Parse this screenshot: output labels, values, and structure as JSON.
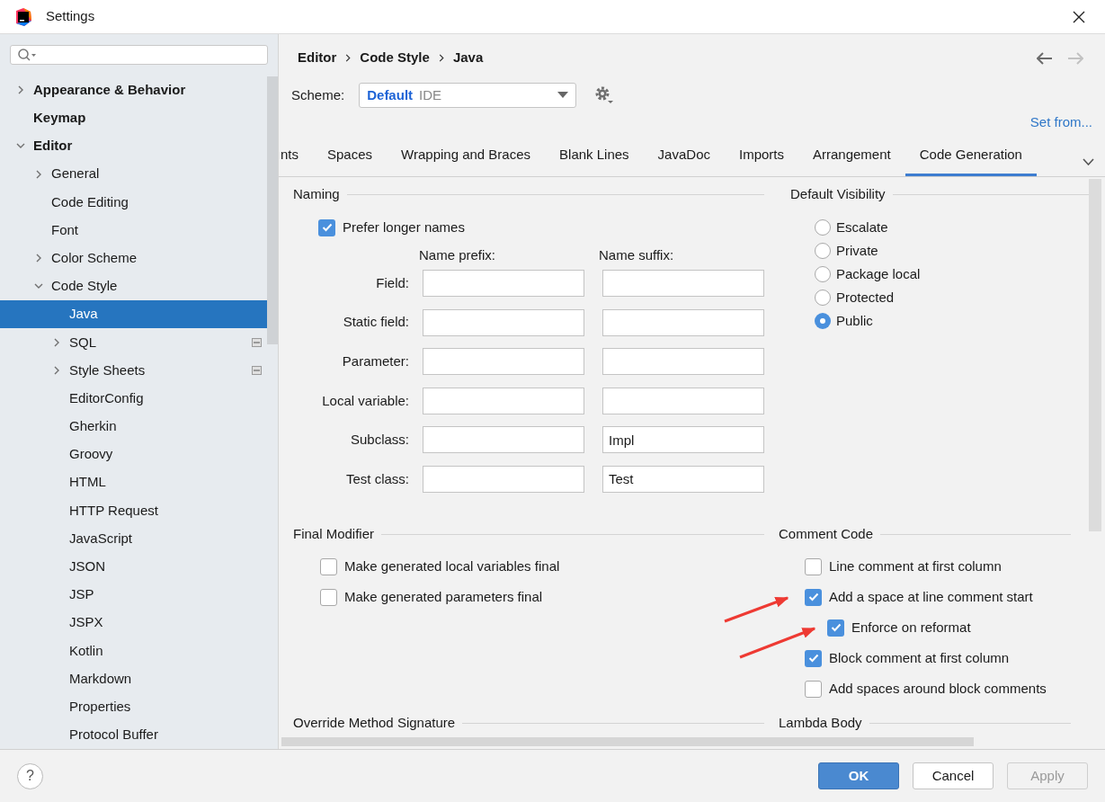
{
  "window": {
    "title": "Settings"
  },
  "tree": [
    {
      "label": "Appearance & Behavior",
      "bold": true,
      "expanded": false,
      "selected": false
    },
    {
      "label": "Keymap",
      "bold": true,
      "selected": false
    },
    {
      "label": "Editor",
      "bold": true,
      "expanded": true,
      "selected": false,
      "children": [
        {
          "label": "General",
          "expanded": false,
          "selected": false
        },
        {
          "label": "Code Editing",
          "selected": false
        },
        {
          "label": "Font",
          "selected": false
        },
        {
          "label": "Color Scheme",
          "expanded": false,
          "selected": false
        },
        {
          "label": "Code Style",
          "expanded": true,
          "selected": false,
          "children": [
            {
              "label": "Java",
              "selected": true
            },
            {
              "label": "SQL",
              "expanded": false,
              "badge": true,
              "selected": false
            },
            {
              "label": "Style Sheets",
              "expanded": false,
              "badge": true,
              "selected": false
            },
            {
              "label": "EditorConfig",
              "selected": false
            },
            {
              "label": "Gherkin",
              "selected": false
            },
            {
              "label": "Groovy",
              "selected": false
            },
            {
              "label": "HTML",
              "selected": false
            },
            {
              "label": "HTTP Request",
              "selected": false
            },
            {
              "label": "JavaScript",
              "selected": false
            },
            {
              "label": "JSON",
              "selected": false
            },
            {
              "label": "JSP",
              "selected": false
            },
            {
              "label": "JSPX",
              "selected": false
            },
            {
              "label": "Kotlin",
              "selected": false
            },
            {
              "label": "Markdown",
              "selected": false
            },
            {
              "label": "Properties",
              "selected": false
            },
            {
              "label": "Protocol Buffer",
              "selected": false
            }
          ]
        }
      ]
    }
  ],
  "breadcrumb": [
    "Editor",
    "Code Style",
    "Java"
  ],
  "nav": {
    "back": {
      "disabled": false
    },
    "forward": {
      "disabled": true
    }
  },
  "scheme": {
    "label": "Scheme:",
    "name": "Default",
    "tag": "IDE"
  },
  "set_from": "Set from...",
  "tabs": [
    {
      "label": "nts",
      "selected": false
    },
    {
      "label": "Spaces",
      "selected": false
    },
    {
      "label": "Wrapping and Braces",
      "selected": false
    },
    {
      "label": "Blank Lines",
      "selected": false
    },
    {
      "label": "JavaDoc",
      "selected": false
    },
    {
      "label": "Imports",
      "selected": false
    },
    {
      "label": "Arrangement",
      "selected": false
    },
    {
      "label": "Code Generation",
      "selected": true
    }
  ],
  "naming": {
    "title": "Naming",
    "prefer_longer": {
      "label": "Prefer longer names",
      "checked": true
    },
    "columns": [
      "Name prefix:",
      "Name suffix:"
    ],
    "rows": [
      {
        "label": "Field:"
      },
      {
        "label": "Static field:"
      },
      {
        "label": "Parameter:"
      },
      {
        "label": "Local variable:"
      },
      {
        "label": "Subclass:",
        "suffix": "Impl"
      },
      {
        "label": "Test class:",
        "suffix": "Test"
      }
    ]
  },
  "default_visibility": {
    "title": "Default Visibility",
    "options": [
      {
        "label": "Escalate",
        "selected": false
      },
      {
        "label": "Private",
        "selected": false
      },
      {
        "label": "Package local",
        "selected": false
      },
      {
        "label": "Protected",
        "selected": false
      },
      {
        "label": "Public",
        "selected": true
      }
    ]
  },
  "final_modifier": {
    "title": "Final Modifier",
    "options": [
      {
        "label": "Make generated local variables final",
        "checked": false
      },
      {
        "label": "Make generated parameters final",
        "checked": false
      }
    ]
  },
  "comment_code": {
    "title": "Comment Code",
    "options": [
      {
        "label": "Line comment at first column",
        "checked": false
      },
      {
        "label": "Add a space at line comment start",
        "checked": true,
        "children": [
          {
            "label": "Enforce on reformat",
            "checked": true
          }
        ]
      },
      {
        "label": "Block comment at first column",
        "checked": true
      },
      {
        "label": "Add spaces around block comments",
        "checked": false
      }
    ]
  },
  "override_method_signature": {
    "title": "Override Method Signature"
  },
  "lambda_body": {
    "title": "Lambda Body"
  },
  "help": "?",
  "buttons": [
    {
      "label": "OK",
      "kind": "primary",
      "disabled": false
    },
    {
      "label": "Cancel",
      "kind": "default",
      "disabled": false
    },
    {
      "label": "Apply",
      "kind": "default",
      "disabled": true
    }
  ]
}
